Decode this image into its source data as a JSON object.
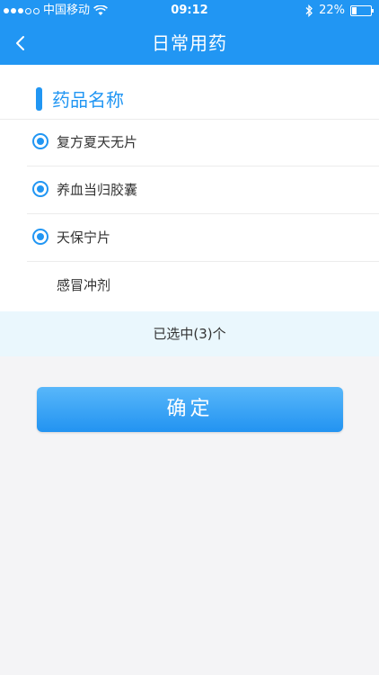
{
  "status": {
    "carrier": "中国移动",
    "time": "09:12",
    "battery": "22%",
    "battery_level": 0.22
  },
  "nav": {
    "title": "日常用药"
  },
  "section": {
    "title": "药品名称"
  },
  "medicines": [
    {
      "name": "复方夏天无片",
      "selected": true
    },
    {
      "name": "养血当归胶囊",
      "selected": true
    },
    {
      "name": "天保宁片",
      "selected": true
    },
    {
      "name": "感冒冲剂",
      "selected": false
    }
  ],
  "summary": {
    "text": "已选中(3)个"
  },
  "actions": {
    "confirm_label": "确定"
  },
  "colors": {
    "primary": "#2196f3",
    "summary_bg": "#eaf7fd"
  }
}
